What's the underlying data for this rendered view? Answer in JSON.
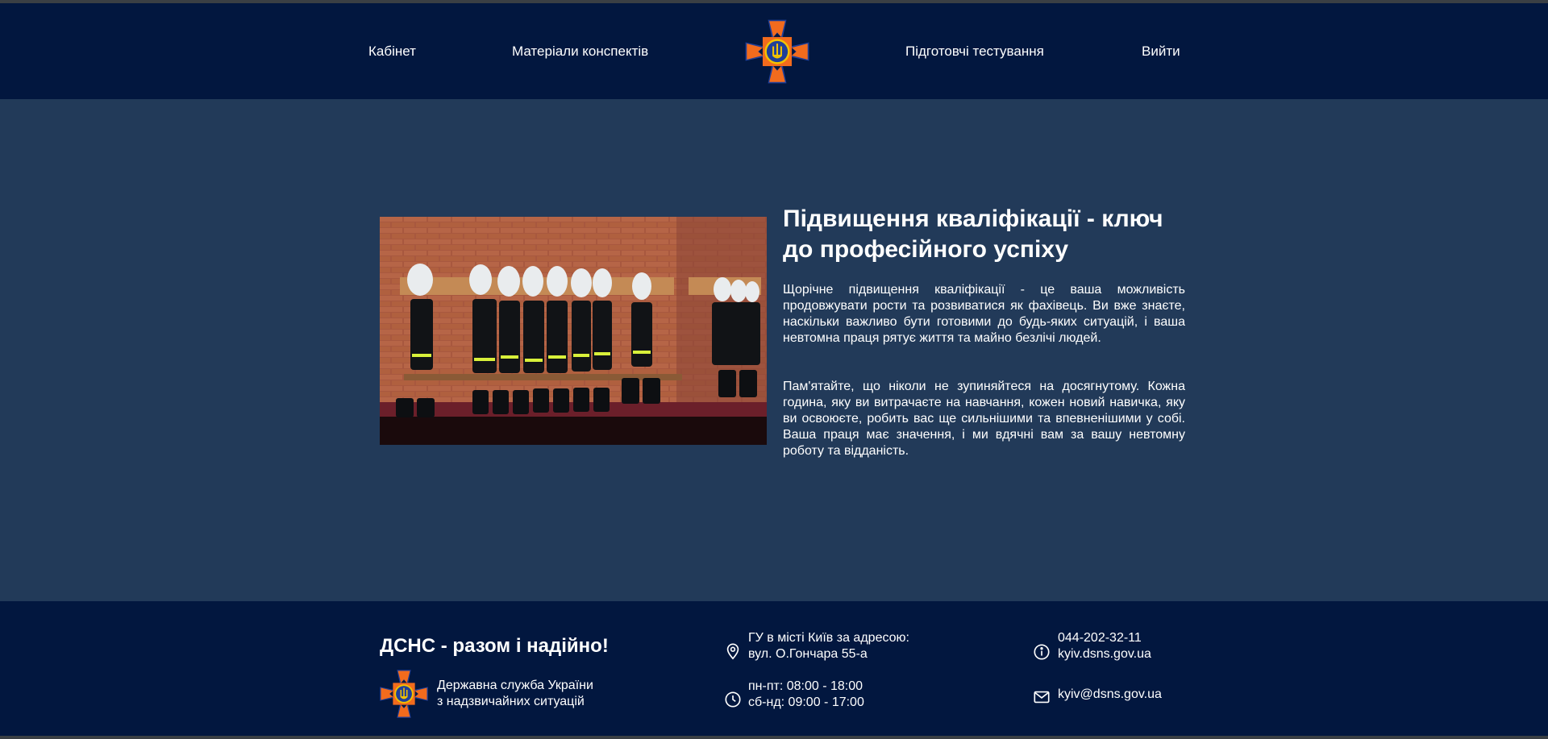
{
  "nav": {
    "cabinet": "Кабінет",
    "materials": "Матеріали конспектів",
    "tests": "Підготовчі тестування",
    "logout": "Вийти"
  },
  "hero": {
    "title": "Підвищення кваліфікації - ключ до професійного успіху",
    "paragraph1": "Щорічне підвищення кваліфікації - це ваша можливість продовжувати рости та розвиватися як фахівець. Ви вже знаєте, наскільки важливо бути готовими до будь-яких ситуацій, і ваша невтомна праця рятує життя та майно безлічі людей.",
    "paragraph2": "Пам'ятайте, що ніколи не зупиняйтеся на досягнутому. Кожна година, яку ви витрачаєте на навчання, кожен новий навичка, яку ви освоюєте, робить вас ще сильнішими та впевненішими у собі. Ваша праця має значення, і ми вдячні вам за вашу невтомну роботу та відданість."
  },
  "footer": {
    "slogan": "ДСНС - разом і надійно!",
    "org_line1": "Державна служба України",
    "org_line2": "з надзвичайних ситуацій",
    "address_line1": "ГУ в місті Київ за адресою:",
    "address_line2": "вул. О.Гончара 55-а",
    "hours_line1": "пн-пт: 08:00 - 18:00",
    "hours_line2": "сб-нд: 09:00 - 17:00",
    "phone": "044-202-32-11",
    "site": "kyiv.dsns.gov.ua",
    "email": "kyiv@dsns.gov.ua"
  },
  "icons": {
    "location": "location-pin-icon",
    "clock": "clock-icon",
    "info": "info-icon",
    "mail": "mail-icon"
  },
  "colors": {
    "header_bg": "#02173f",
    "main_bg": "#223a59",
    "emblem_orange": "#f26b1d",
    "emblem_blue": "#1f3f99",
    "emblem_gold": "#f2c200"
  }
}
